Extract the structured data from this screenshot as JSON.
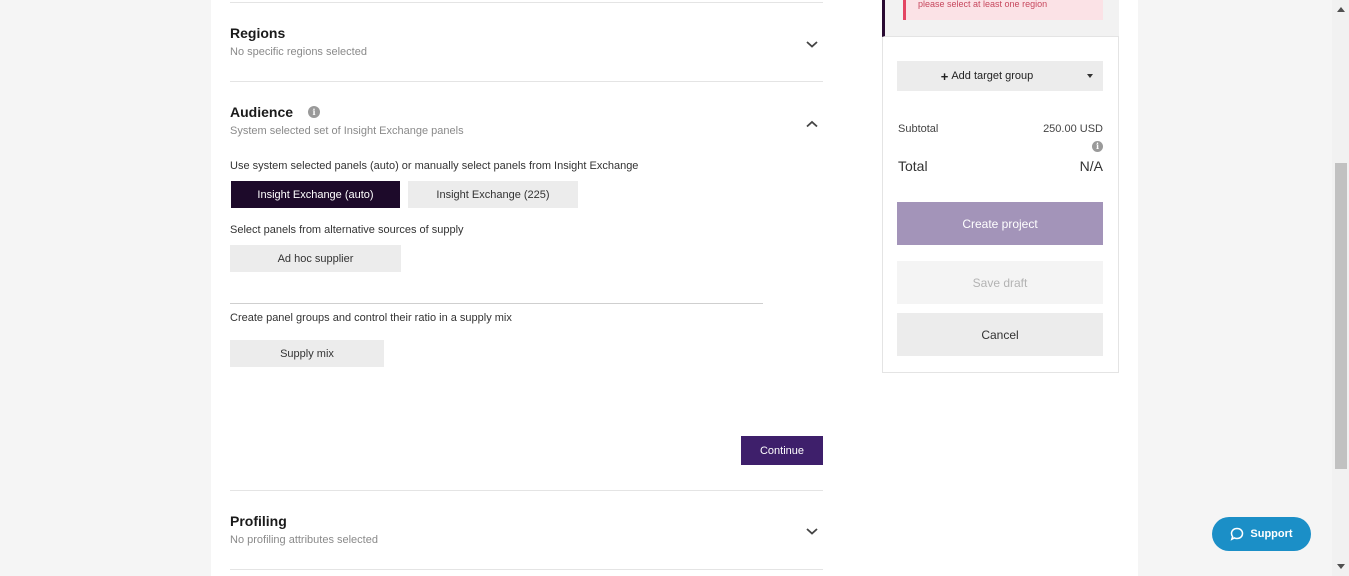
{
  "regions": {
    "title": "Regions",
    "subtitle": "No specific regions selected"
  },
  "audience": {
    "title": "Audience",
    "subtitle": "System selected set of Insight Exchange panels",
    "panels_instruction": "Use system selected panels (auto) or manually select panels from Insight Exchange",
    "auto_button": "Insight Exchange (auto)",
    "manual_button": "Insight Exchange (225)",
    "alt_supply_instruction": "Select panels from alternative sources of supply",
    "adhoc_button": "Ad hoc supplier",
    "supply_mix_instruction": "Create panel groups and control their ratio in a supply mix",
    "supply_mix_button": "Supply mix",
    "continue_button": "Continue"
  },
  "profiling": {
    "title": "Profiling",
    "subtitle": "No profiling attributes selected"
  },
  "sidebar": {
    "alert_text": "please select at least one region",
    "add_group_plus": "+",
    "add_group_label": "Add target group",
    "subtotal_label": "Subtotal",
    "subtotal_value": "250.00 USD",
    "total_label": "Total",
    "total_value": "N/A",
    "create_button": "Create project",
    "save_draft_button": "Save draft",
    "cancel_button": "Cancel"
  },
  "support": {
    "label": "Support"
  },
  "colors": {
    "brand_dark": "#1d0a2a",
    "brand_purple": "#3e1f6b",
    "create_disabled": "#a394b9",
    "alert_red": "#e44563",
    "support_blue": "#1b8fc7"
  }
}
